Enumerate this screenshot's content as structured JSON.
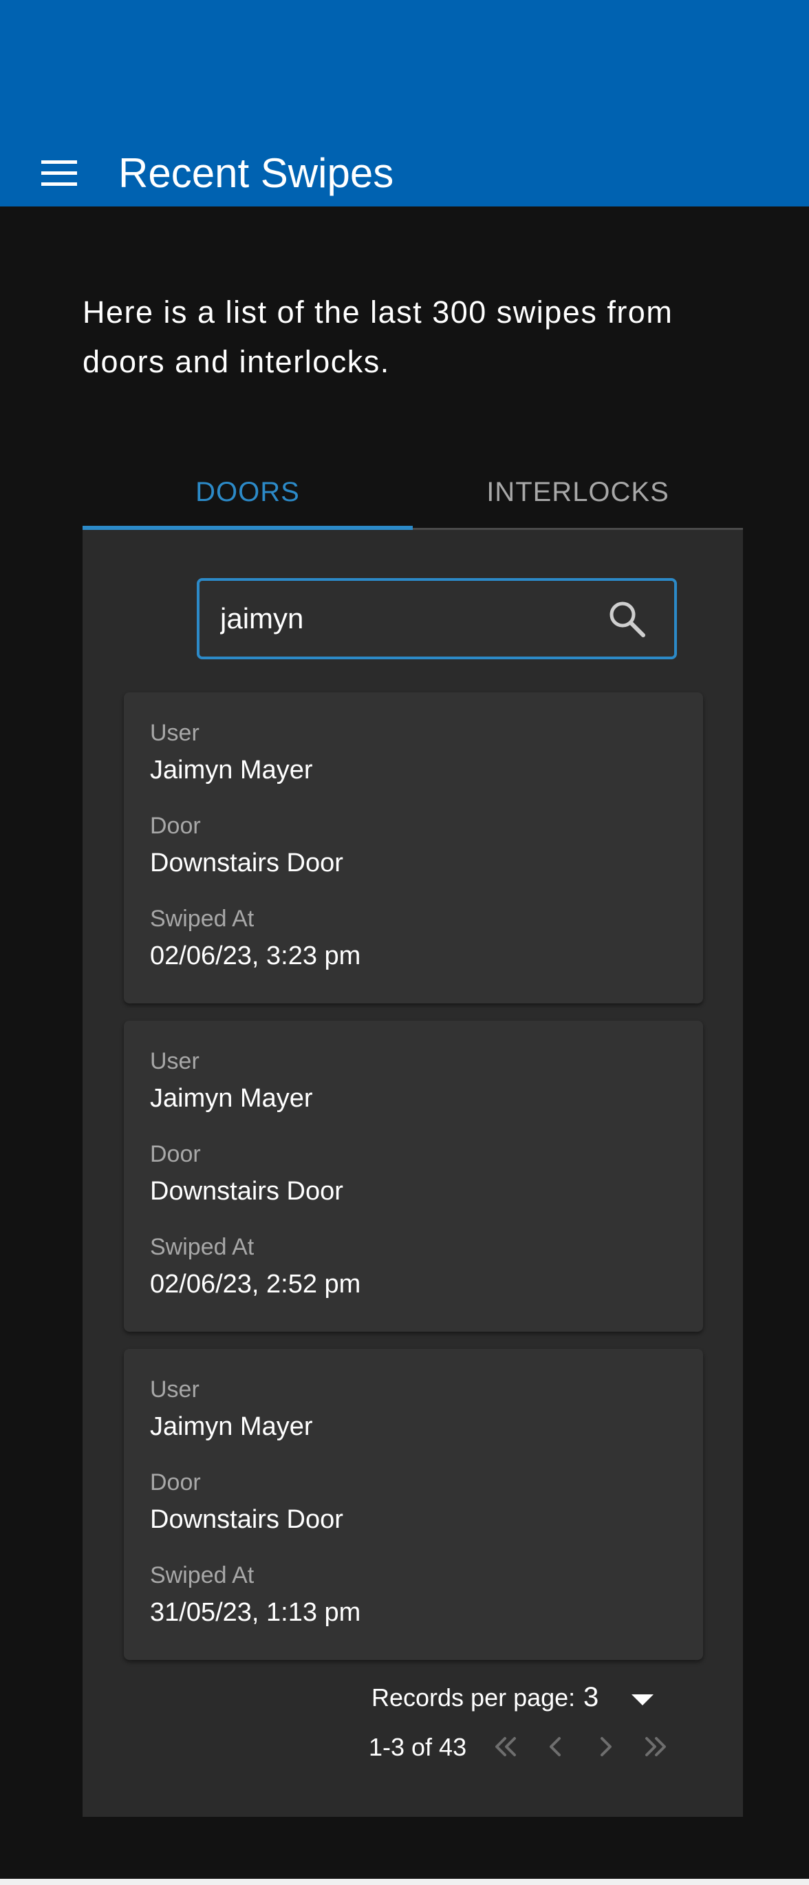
{
  "app_bar": {
    "title": "Recent Swipes",
    "menu_icon": "menu-icon",
    "color": "#0062b1"
  },
  "intro": {
    "text": "Here is a list of the last 300 swipes from doors and interlocks."
  },
  "tabs": [
    {
      "label": "DOORS",
      "active": true
    },
    {
      "label": "INTERLOCKS",
      "active": false
    }
  ],
  "search": {
    "value": "jaimyn",
    "icon": "search-icon"
  },
  "swipes": [
    {
      "user_label": "User",
      "user": "Jaimyn Mayer",
      "door_label": "Door",
      "door": "Downstairs Door",
      "swiped_label": "Swiped At",
      "swiped_at": "02/06/23, 3:23 pm"
    },
    {
      "user_label": "User",
      "user": "Jaimyn Mayer",
      "door_label": "Door",
      "door": "Downstairs Door",
      "swiped_label": "Swiped At",
      "swiped_at": "02/06/23, 2:52 pm"
    },
    {
      "user_label": "User",
      "user": "Jaimyn Mayer",
      "door_label": "Door",
      "door": "Downstairs Door",
      "swiped_label": "Swiped At",
      "swiped_at": "31/05/23, 1:13 pm"
    }
  ],
  "pagination": {
    "records_per_page_label": "Records per page:",
    "records_per_page": "3",
    "range": "1-3 of 43",
    "first_icon": "first-page-icon",
    "prev_icon": "chevron-left-icon",
    "next_icon": "chevron-right-icon",
    "last_icon": "last-page-icon"
  },
  "colors": {
    "accent": "#2c8ac8",
    "background": "#121212",
    "panel": "#2b2b2b",
    "card": "#333333"
  }
}
